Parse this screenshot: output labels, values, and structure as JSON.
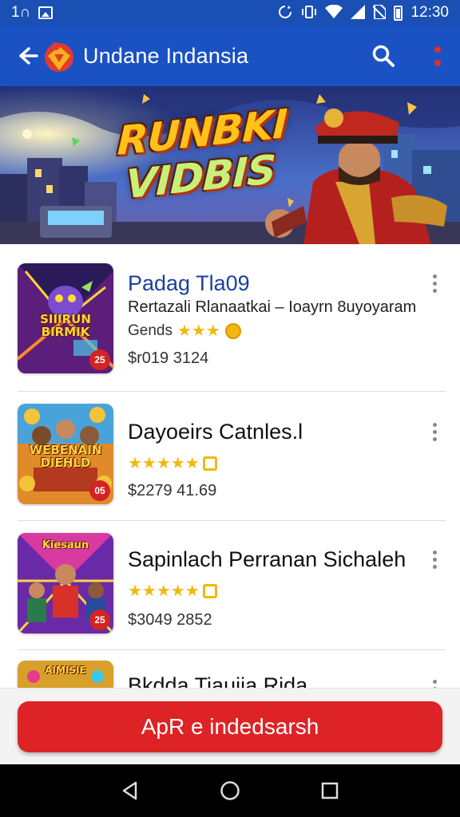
{
  "status_bar": {
    "left_text": "1∩",
    "time": "12:30",
    "icons": [
      "image-icon",
      "sync-icon",
      "vibrate-icon",
      "wifi-icon",
      "signal-icon",
      "no-sim-icon",
      "battery-icon"
    ]
  },
  "app_bar": {
    "title": "Undane Indansia",
    "icons": [
      "back-arrow-icon",
      "app-logo",
      "search-icon",
      "more-vert-icon"
    ]
  },
  "banner": {
    "title_line1": "RUNBKI",
    "title_line2": "VIDBIS"
  },
  "games": [
    {
      "title": "Padag Tla09",
      "description": "Rertazali Rlanaatkai – Ioayrn 8uyoyaram",
      "category": "Gends",
      "price": "$r019 3124",
      "badge": "25",
      "thumb_label": "SIIIRUN BIRMIK"
    },
    {
      "title": "Dayoeirs Catnles.l",
      "price": "$2279 41.69",
      "badge": "05",
      "thumb_label": "WEBENAIN DIEHLD"
    },
    {
      "title": "Sapinlach Perranan Sichaleh",
      "price": "$3049 2852",
      "badge": "25",
      "thumb_label": "Kiesaun"
    },
    {
      "title": "Bkdda Tiauiia Rida",
      "thumb_label": "AIMISIE"
    }
  ],
  "action_button": {
    "label": "ApR e indedsarsh"
  },
  "colors": {
    "app_bar": "#1a52c4",
    "status_bar": "#1a4fb4",
    "action_button": "#dd2325",
    "star": "#f2b80f"
  }
}
